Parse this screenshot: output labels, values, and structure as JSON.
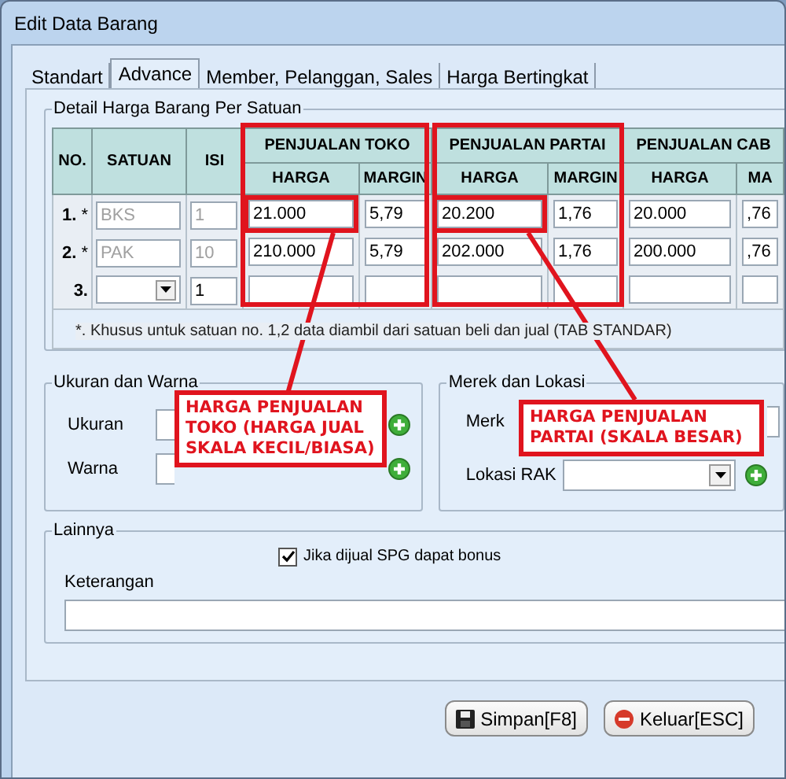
{
  "window": {
    "title": "Edit Data Barang"
  },
  "tabs": [
    {
      "label": "Standart",
      "selected": false
    },
    {
      "label": "Advance",
      "selected": true
    },
    {
      "label": "Member, Pelanggan, Sales",
      "selected": false
    },
    {
      "label": "Harga Bertingkat",
      "selected": false
    }
  ],
  "detail": {
    "title": "Detail Harga Barang Per Satuan",
    "columns": [
      "NO.",
      "SATUAN",
      "ISI"
    ],
    "groups": [
      {
        "title": "PENJUALAN TOKO",
        "subs": [
          "HARGA",
          "MARGIN"
        ],
        "highlighted": true
      },
      {
        "title": "PENJUALAN PARTAI",
        "subs": [
          "HARGA",
          "MARGIN"
        ],
        "highlighted": true
      },
      {
        "title": "PENJUALAN CAB",
        "subs": [
          "HARGA",
          "MA"
        ],
        "highlighted": false
      }
    ],
    "rows": [
      {
        "no": "1.",
        "marker": "*",
        "highlighted": true,
        "unit": {
          "kind": "text",
          "value": "BKS",
          "disabled": true
        },
        "qty": {
          "value": "1",
          "disabled": true
        },
        "prices": [
          "21.000",
          "5,79",
          "20.200",
          "1,76",
          "20.000",
          ",76"
        ]
      },
      {
        "no": "2.",
        "marker": "*",
        "highlighted": false,
        "unit": {
          "kind": "text",
          "value": "PAK",
          "disabled": true
        },
        "qty": {
          "value": "10",
          "disabled": true
        },
        "prices": [
          "210.000",
          "5,79",
          "202.000",
          "1,76",
          "200.000",
          ",76"
        ]
      },
      {
        "no": "3.",
        "highlighted": false,
        "unit": {
          "kind": "dropdown",
          "disabled": false
        },
        "qty": {
          "value": "1",
          "disabled": false
        },
        "prices": []
      }
    ],
    "footnote": "*. Khusus untuk satuan no. 1,2 data diambil dari satuan beli dan jual (TAB STANDAR)"
  },
  "size_color": {
    "title": "Ukuran dan Warna",
    "fields": [
      {
        "label": "Ukuran"
      },
      {
        "label": "Warna"
      }
    ]
  },
  "brand_location": {
    "title": "Merek dan Lokasi",
    "fields": [
      {
        "label": "Merk",
        "kind": "text"
      },
      {
        "label": "Lokasi RAK",
        "kind": "dropdown"
      }
    ]
  },
  "other": {
    "title": "Lainnya",
    "checkbox": {
      "label": "Jika dijual SPG dapat bonus",
      "checked": true
    },
    "field": {
      "label": "Keterangan"
    }
  },
  "buttons": [
    {
      "label": "Simpan[F8]",
      "kind": "save"
    },
    {
      "label": "Keluar[ESC]",
      "kind": "exit"
    }
  ],
  "annotations": [
    {
      "text": "HARGA PENJUALAN TOKO (HARGA JUAL SKALA KECIL/BIASA)"
    },
    {
      "text": "HARGA PENJUALAN PARTAI (SKALA BESAR)"
    }
  ]
}
